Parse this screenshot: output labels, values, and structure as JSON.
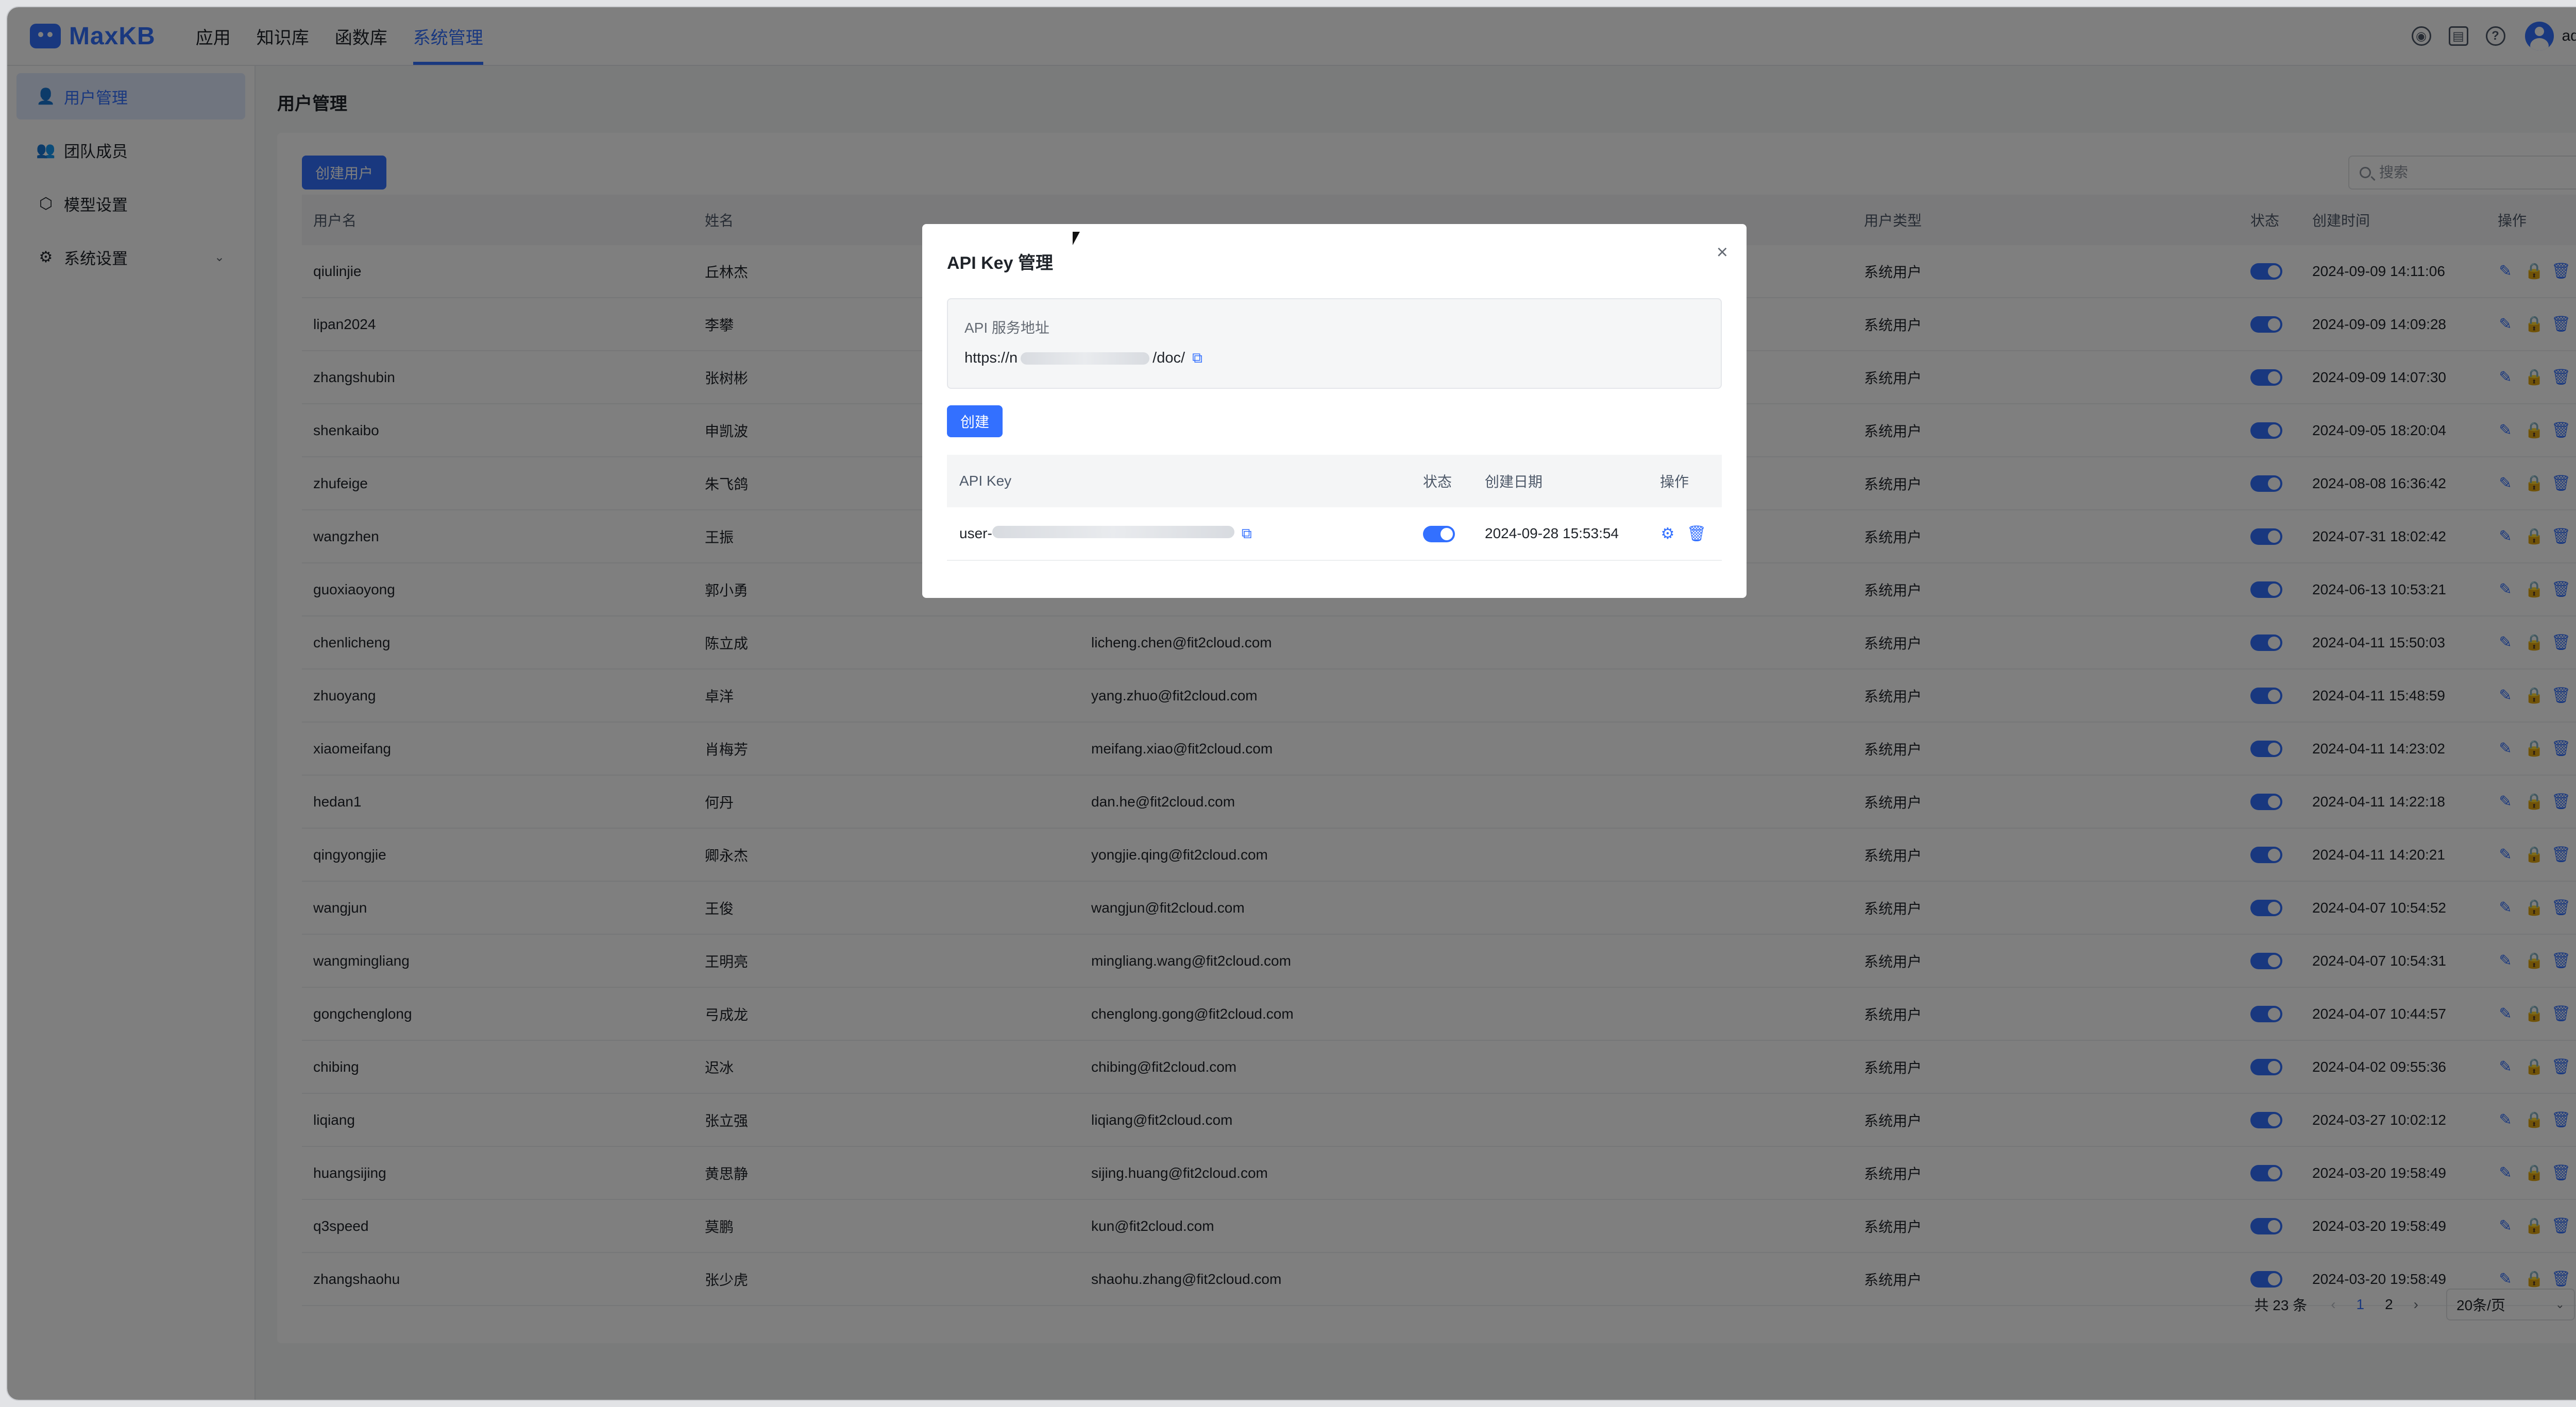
{
  "header": {
    "logo": "MaxKB",
    "nav": [
      "应用",
      "知识库",
      "函数库",
      "系统管理"
    ],
    "active_nav": 3,
    "icons": [
      "github-icon",
      "book-icon",
      "help-icon"
    ],
    "user": "admin"
  },
  "sidebar": {
    "items": [
      {
        "label": "用户管理",
        "icon": "user-icon",
        "active": true
      },
      {
        "label": "团队成员",
        "icon": "team-icon",
        "active": false
      },
      {
        "label": "模型设置",
        "icon": "cube-icon",
        "active": false
      },
      {
        "label": "系统设置",
        "icon": "gear-icon",
        "active": false,
        "expandable": true
      }
    ]
  },
  "main": {
    "title": "用户管理",
    "create_button": "创建用户",
    "search_placeholder": "搜索",
    "columns": [
      "用户名",
      "姓名",
      "",
      "",
      "用户类型",
      "状态",
      "创建时间",
      "操作"
    ],
    "rows": [
      {
        "username": "qiulinjie",
        "name": "丘林杰",
        "email": "",
        "type": "系统用户",
        "created": "2024-09-09 14:11:06"
      },
      {
        "username": "lipan2024",
        "name": "李攀",
        "email": "",
        "type": "系统用户",
        "created": "2024-09-09 14:09:28"
      },
      {
        "username": "zhangshubin",
        "name": "张树彬",
        "email": "",
        "type": "系统用户",
        "created": "2024-09-09 14:07:30"
      },
      {
        "username": "shenkaibo",
        "name": "申凯波",
        "email": "",
        "type": "系统用户",
        "created": "2024-09-05 18:20:04"
      },
      {
        "username": "zhufeige",
        "name": "朱飞鸽",
        "email": "",
        "type": "系统用户",
        "created": "2024-08-08 16:36:42"
      },
      {
        "username": "wangzhen",
        "name": "王振",
        "email": "",
        "type": "系统用户",
        "created": "2024-07-31 18:02:42"
      },
      {
        "username": "guoxiaoyong",
        "name": "郭小勇",
        "email": "",
        "type": "系统用户",
        "created": "2024-06-13 10:53:21"
      },
      {
        "username": "chenlicheng",
        "name": "陈立成",
        "email": "licheng.chen@fit2cloud.com",
        "type": "系统用户",
        "created": "2024-04-11 15:50:03"
      },
      {
        "username": "zhuoyang",
        "name": "卓洋",
        "email": "yang.zhuo@fit2cloud.com",
        "type": "系统用户",
        "created": "2024-04-11 15:48:59"
      },
      {
        "username": "xiaomeifang",
        "name": "肖梅芳",
        "email": "meifang.xiao@fit2cloud.com",
        "type": "系统用户",
        "created": "2024-04-11 14:23:02"
      },
      {
        "username": "hedan1",
        "name": "何丹",
        "email": "dan.he@fit2cloud.com",
        "type": "系统用户",
        "created": "2024-04-11 14:22:18"
      },
      {
        "username": "qingyongjie",
        "name": "卿永杰",
        "email": "yongjie.qing@fit2cloud.com",
        "type": "系统用户",
        "created": "2024-04-11 14:20:21"
      },
      {
        "username": "wangjun",
        "name": "王俊",
        "email": "wangjun@fit2cloud.com",
        "type": "系统用户",
        "created": "2024-04-07 10:54:52"
      },
      {
        "username": "wangmingliang",
        "name": "王明亮",
        "email": "mingliang.wang@fit2cloud.com",
        "type": "系统用户",
        "created": "2024-04-07 10:54:31"
      },
      {
        "username": "gongchenglong",
        "name": "弓成龙",
        "email": "chenglong.gong@fit2cloud.com",
        "type": "系统用户",
        "created": "2024-04-07 10:44:57"
      },
      {
        "username": "chibing",
        "name": "迟冰",
        "email": "chibing@fit2cloud.com",
        "type": "系统用户",
        "created": "2024-04-02 09:55:36"
      },
      {
        "username": "liqiang",
        "name": "张立强",
        "email": "liqiang@fit2cloud.com",
        "type": "系统用户",
        "created": "2024-03-27 10:02:12"
      },
      {
        "username": "huangsijing",
        "name": "黄思静",
        "email": "sijing.huang@fit2cloud.com",
        "type": "系统用户",
        "created": "2024-03-20 19:58:49"
      },
      {
        "username": "q3speed",
        "name": "莫鹏",
        "email": "kun@fit2cloud.com",
        "type": "系统用户",
        "created": "2024-03-20 19:58:49"
      },
      {
        "username": "zhangshaohu",
        "name": "张少虎",
        "email": "shaohu.zhang@fit2cloud.com",
        "type": "系统用户",
        "created": "2024-03-20 19:58:49"
      }
    ],
    "pager": {
      "total": "共 23 条",
      "pages": [
        "1",
        "2"
      ],
      "current": "1",
      "page_size": "20条/页",
      "prev": "‹",
      "next": "›"
    }
  },
  "dialog": {
    "title": "API Key 管理",
    "close": "×",
    "api_label": "API 服务地址",
    "api_url_prefix": "https://n",
    "api_url_suffix": "/doc/",
    "create_button": "创建",
    "columns": [
      "API Key",
      "状态",
      "创建日期",
      "操作"
    ],
    "keys": [
      {
        "key_prefix": "user-",
        "created": "2024-09-28 15:53:54"
      }
    ]
  },
  "icons": {
    "edit": "✎",
    "lock": "🔒",
    "delete": "🗑",
    "copy": "⧉",
    "settings": "⚙",
    "chevron": "⌄"
  },
  "colors": {
    "primary": "#3370ff",
    "active_bg": "#e1eaff"
  }
}
